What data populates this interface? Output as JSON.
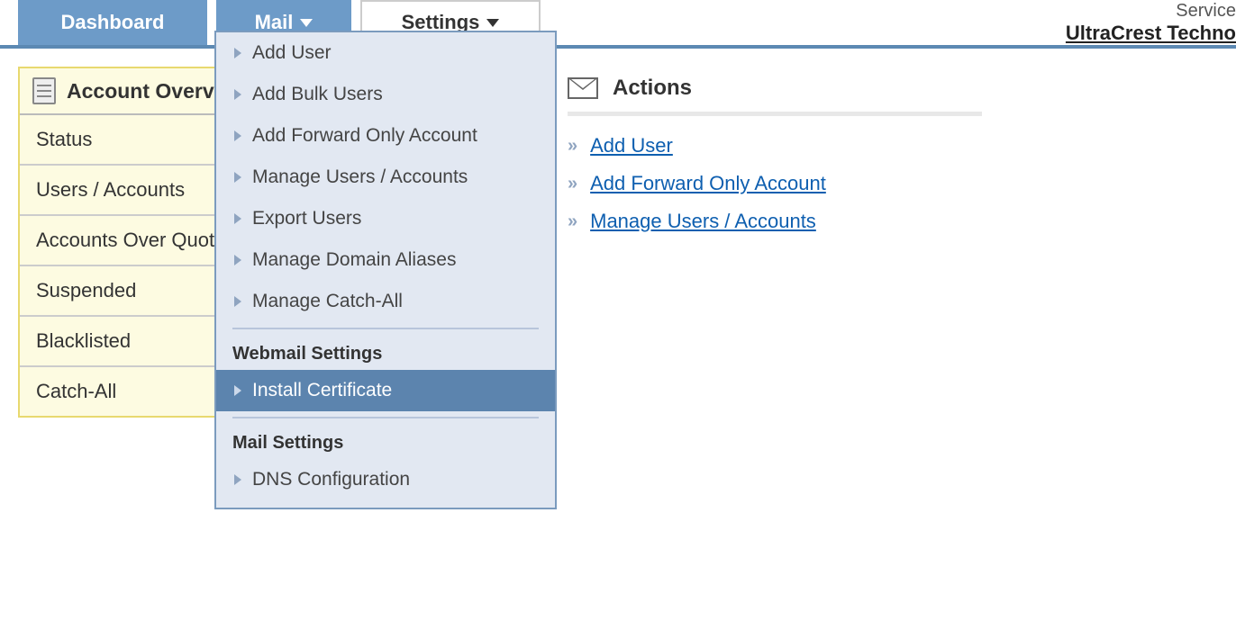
{
  "nav": {
    "dashboard": "Dashboard",
    "mail": "Mail",
    "settings": "Settings"
  },
  "branding": {
    "line1": "Service",
    "name": "UltraCrest Techno"
  },
  "sidebar": {
    "title": "Account Overview",
    "items": [
      "Status",
      "Users / Accounts",
      "Accounts Over Quota",
      "Suspended",
      "Blacklisted",
      "Catch-All"
    ]
  },
  "mailMenu": {
    "group1": [
      "Add User",
      "Add Bulk Users",
      "Add Forward Only Account",
      "Manage Users / Accounts",
      "Export Users",
      "Manage Domain Aliases",
      "Manage Catch-All"
    ],
    "groupWebmailTitle": "Webmail Settings",
    "groupWebmail": [
      "Install Certificate"
    ],
    "groupMailTitle": "Mail Settings",
    "groupMail": [
      "DNS Configuration"
    ],
    "highlighted": "Install Certificate"
  },
  "actions": {
    "title": "Actions",
    "links": [
      "Add User",
      "Add Forward Only Account",
      "Manage Users / Accounts"
    ]
  }
}
